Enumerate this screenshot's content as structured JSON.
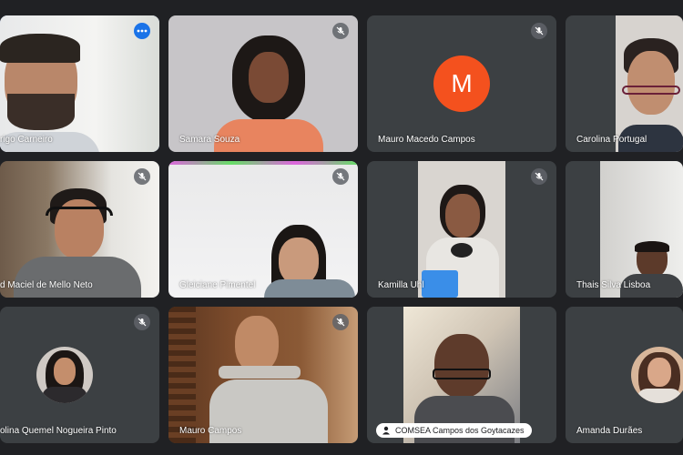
{
  "participants": [
    {
      "name": "rigo Carneiro"
    },
    {
      "name": "Samara Souza"
    },
    {
      "name": "Mauro Macedo Campos",
      "initial": "M",
      "avatar_color": "#f4511e"
    },
    {
      "name": "Carolina Portugal"
    },
    {
      "name": "d Maciel de Mello Neto"
    },
    {
      "name": "Gleiciane Pimentel"
    },
    {
      "name": "Kamilla Uhl"
    },
    {
      "name": "Thais Silva Lisboa"
    },
    {
      "name": "olina Quemel Nogueira Pinto"
    },
    {
      "name": "Mauro Campos"
    },
    {
      "name": "COMSEA Campos dos Goytacazes"
    },
    {
      "name": "Amanda Durães"
    }
  ],
  "colors": {
    "background": "#202124",
    "tile": "#3c4043",
    "active_border": "#8ab4f8"
  },
  "icons": {
    "muted": "mic-off-icon",
    "more": "more-options-icon",
    "host": "presenter-icon"
  }
}
